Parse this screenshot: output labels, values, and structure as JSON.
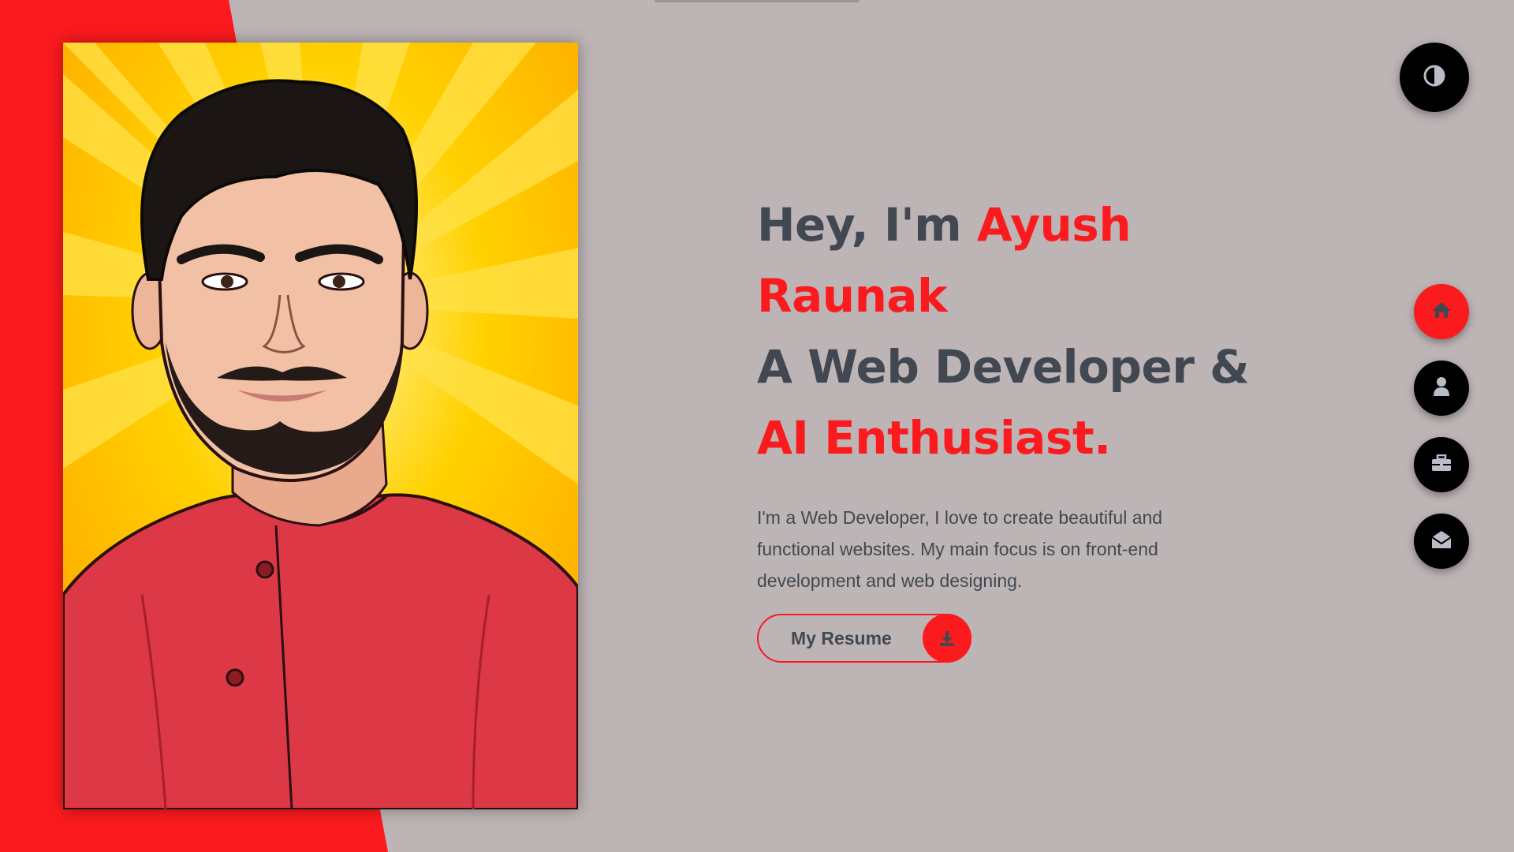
{
  "colors": {
    "accent": "#fb1a1e",
    "text": "#414852",
    "background": "#bdb4b5",
    "button_dark": "#000000"
  },
  "portrait": {
    "alt": "Cartoon portrait of Ayush Raunak in a red shirt"
  },
  "hero": {
    "greeting": "Hey, I'm",
    "name_first": "Ayush",
    "name_last": "Raunak",
    "role_prefix": "A Web Developer &",
    "role_accent": "AI Enthusiast.",
    "description": "I'm a Web Developer, I love to create beautiful and functional websites. My main focus is on front-end development and web designing."
  },
  "resume_button": {
    "label": "My Resume",
    "icon": "download-icon"
  },
  "theme_toggle": {
    "icon": "contrast-icon"
  },
  "nav": {
    "items": [
      {
        "name": "home",
        "icon": "home-icon",
        "active": true
      },
      {
        "name": "about",
        "icon": "user-icon",
        "active": false
      },
      {
        "name": "portfolio",
        "icon": "briefcase-icon",
        "active": false
      },
      {
        "name": "contact",
        "icon": "envelope-open-icon",
        "active": false
      }
    ]
  }
}
